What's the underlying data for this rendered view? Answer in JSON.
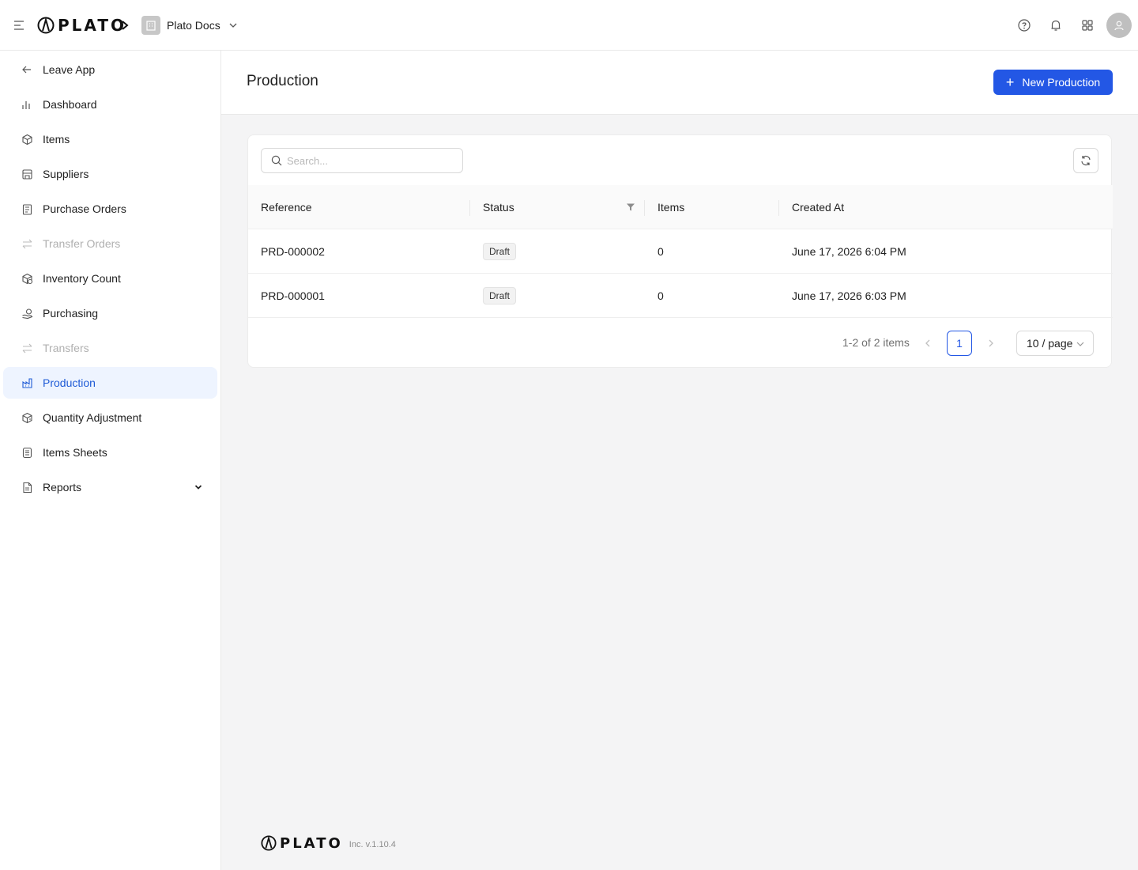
{
  "header": {
    "logo_text": "PLATO",
    "workspace_name": "Plato Docs"
  },
  "sidebar": {
    "items": [
      {
        "label": "Leave App",
        "icon": "arrow-left-icon"
      },
      {
        "label": "Dashboard",
        "icon": "bar-chart-icon"
      },
      {
        "label": "Items",
        "icon": "box-icon"
      },
      {
        "label": "Suppliers",
        "icon": "store-icon"
      },
      {
        "label": "Purchase Orders",
        "icon": "clipboard-icon"
      },
      {
        "label": "Transfer Orders",
        "icon": "transfer-icon"
      },
      {
        "label": "Inventory Count",
        "icon": "boxes-icon"
      },
      {
        "label": "Purchasing",
        "icon": "hand-coin-icon"
      },
      {
        "label": "Transfers",
        "icon": "transfer-icon"
      },
      {
        "label": "Production",
        "icon": "factory-icon"
      },
      {
        "label": "Quantity Adjustment",
        "icon": "box-adjust-icon"
      },
      {
        "label": "Items Sheets",
        "icon": "sheet-icon"
      },
      {
        "label": "Reports",
        "icon": "report-icon"
      }
    ]
  },
  "page": {
    "title": "Production",
    "new_button_label": "New Production"
  },
  "search": {
    "placeholder": "Search..."
  },
  "table": {
    "columns": [
      "Reference",
      "Status",
      "Items",
      "Created At"
    ],
    "rows": [
      {
        "reference": "PRD-000002",
        "status": "Draft",
        "items": "0",
        "created_at": "June 17, 2026 6:04 PM"
      },
      {
        "reference": "PRD-000001",
        "status": "Draft",
        "items": "0",
        "created_at": "June 17, 2026 6:03 PM"
      }
    ]
  },
  "pagination": {
    "total_text": "1-2 of 2 items",
    "current_page": "1",
    "page_size": "10 / page"
  },
  "footer": {
    "logo_text": "PLATO",
    "version": "Inc. v.1.10.4"
  },
  "colors": {
    "accent": "#2357e5",
    "active_bg": "#eef4ff",
    "content_bg": "#f4f4f5"
  }
}
